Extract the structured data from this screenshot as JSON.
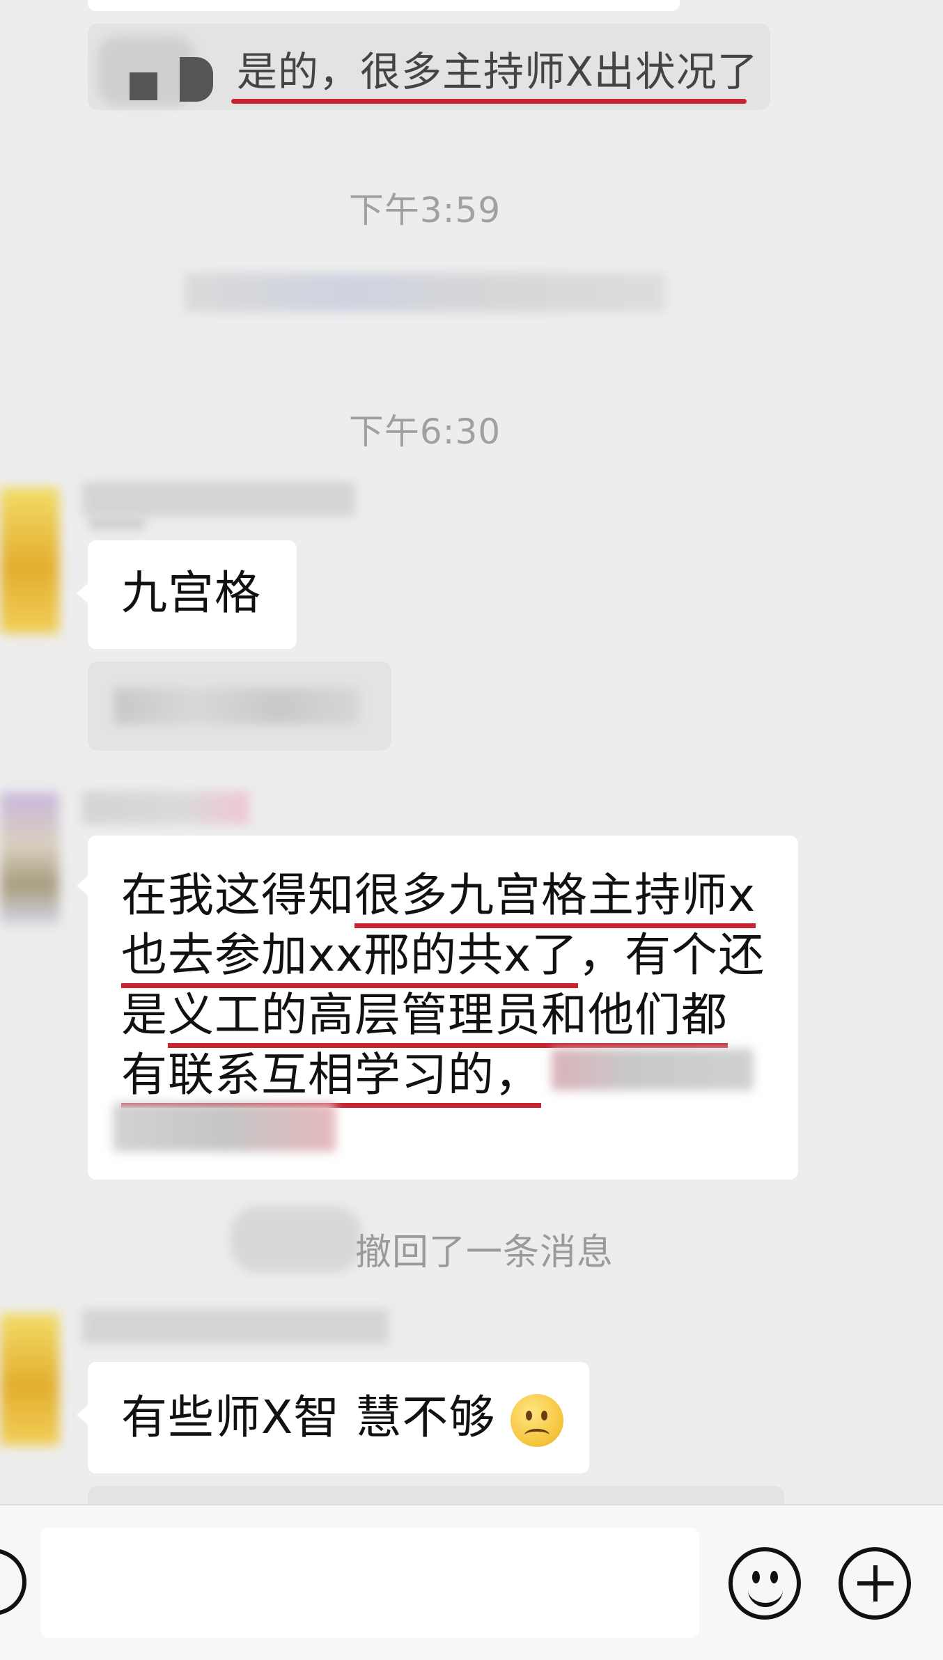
{
  "messages": {
    "reply_quote": "是的，很多主持师X出状况了",
    "time_1": "下午3:59",
    "time_2": "下午6:30",
    "msg_jiugongge": "九宫格",
    "long_msg": {
      "line1_a": "在我这得知",
      "line1_b": "很多九宫格主持师x",
      "line2_a": "也去参加xx邢的共x了",
      "line2_b": "，有个还",
      "line3_a": "是",
      "line3_b": "义工的高层管理员和他们都",
      "line4": "有联系互相学习的，"
    },
    "recall_notice": "撤回了一条消息",
    "last_msg": "有些师X智 慧不够"
  },
  "icons": {
    "emoji_sad": "sad-face-emoji",
    "emoji_button": "smiley-icon",
    "plus_button": "plus-icon",
    "voice_button": "voice-icon"
  },
  "colors": {
    "background": "#ededed",
    "bubble": "#ffffff",
    "underline": "#c8242f",
    "time_text": "#a0a0a0"
  }
}
